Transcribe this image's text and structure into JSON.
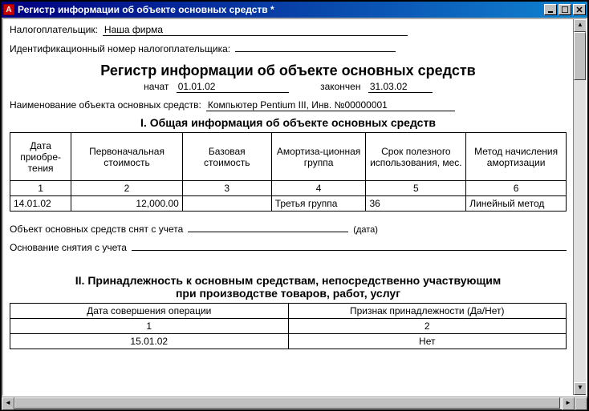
{
  "window": {
    "title": "Регистр информации об объекте основных средств  *"
  },
  "header": {
    "taxpayer_label": "Налогоплательщик:",
    "taxpayer_value": "Наша фирма",
    "tin_label": "Идентификационный номер налогоплательщика:",
    "tin_value": ""
  },
  "main_title": "Регистр информации об объекте основных средств",
  "period": {
    "start_label": "начат",
    "start_value": "01.01.02",
    "end_label": "закончен",
    "end_value": "31.03.02"
  },
  "object": {
    "label": "Наименование объекта основных средств:",
    "value": "Компьютер Pentium III, Инв. №00000001"
  },
  "section1": {
    "title": "I. Общая информация об объекте основных средств",
    "headers": [
      "Дата приобре-тения",
      "Первоначальная стоимость",
      "Базовая стоимость",
      "Амортиза-ционная группа",
      "Срок полезного использования, мес.",
      "Метод начисления амортизации"
    ],
    "numrow": [
      "1",
      "2",
      "3",
      "4",
      "5",
      "6"
    ],
    "datarow": [
      "14.01.02",
      "12,000.00",
      "",
      "Третья группа",
      "36",
      "Линейный метод"
    ]
  },
  "deregistration": {
    "label": "Объект основных средств снят с учета",
    "value": "",
    "note": "(дата)",
    "reason_label": "Основание снятия с учета",
    "reason_value": ""
  },
  "section2": {
    "title_line1": "II. Принадлежность к основным средствам, непосредственно участвующим",
    "title_line2": "при производстве товаров, работ, услуг",
    "headers": [
      "Дата совершения операции",
      "Признак принадлежности (Да/Нет)"
    ],
    "numrow": [
      "1",
      "2"
    ],
    "datarow": [
      "15.01.02",
      "Нет"
    ]
  }
}
